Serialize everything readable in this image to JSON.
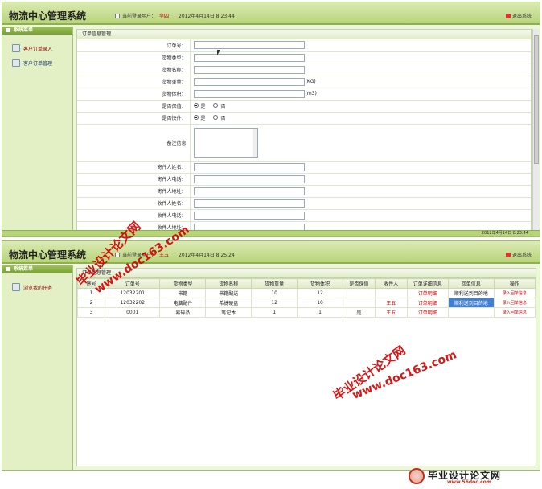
{
  "system_title": "物流中心管理系统",
  "login_label": "当前登录用户：",
  "exit_label": "退出系统",
  "menu_header": "系统菜单",
  "screen1": {
    "user": "李四",
    "time": "2012年4月14日 8:23:44",
    "menu": [
      "客户订单录入",
      "客户订单管理"
    ],
    "panel_title": "订单信息管理",
    "fields": {
      "order_no": "订单号：",
      "goods_type": "货物类型：",
      "goods_name": "货物名称：",
      "goods_weight": "货物重量：",
      "goods_volume": "货物体积：",
      "insured": "是否保值：",
      "fragile": "是否快件：",
      "remark": "备注信息",
      "sender_name": "寄件人姓名：",
      "sender_phone": "寄件人电话：",
      "sender_addr": "寄件人地址：",
      "receiver_name": "收件人姓名：",
      "receiver_phone": "收件人电话：",
      "receiver_addr": "收件人地址："
    },
    "unit_weight": "(KG)",
    "unit_volume": "(m3)",
    "radio_yes": "是",
    "radio_no": "否",
    "footer_time": "2012年4月14日 8:23:44"
  },
  "screen2": {
    "user": "王五",
    "time": "2012年4月14日 8:25:24",
    "menu": [
      "浏览我的任务"
    ],
    "panel_title": "订单信息管理",
    "columns": [
      "序号",
      "订单号",
      "货物类型",
      "货物名称",
      "货物重量",
      "货物体积",
      "是否保值",
      "收件人",
      "订单详细信息",
      "回单信息",
      "操作"
    ],
    "rows": [
      {
        "no": "1",
        "order": "12032201",
        "type": "书籍",
        "name": "书籍配送",
        "weight": "10",
        "volume": "12",
        "insured": "",
        "receiver": "",
        "detail": "订单明细",
        "receipt": "顺利送到目的地",
        "op": "录入回单信息"
      },
      {
        "no": "2",
        "order": "12032202",
        "type": "电脑配件",
        "name": "希捷硬盘",
        "weight": "12",
        "volume": "10",
        "insured": "",
        "receiver": "王五",
        "detail": "订单明细",
        "receipt": "顺利送到目的地",
        "op": "录入回单信息"
      },
      {
        "no": "3",
        "order": "0001",
        "type": "易碎品",
        "name": "笔记本",
        "weight": "1",
        "volume": "1",
        "insured": "是",
        "receiver": "王五",
        "detail": "订单明细",
        "receipt": "",
        "op": "录入回单信息"
      }
    ]
  },
  "watermarks": {
    "cn": "毕业设计论文网",
    "url": "www.doc163.com"
  },
  "brand": {
    "name": "毕业设计论文网",
    "url": "www.56doc.com"
  }
}
